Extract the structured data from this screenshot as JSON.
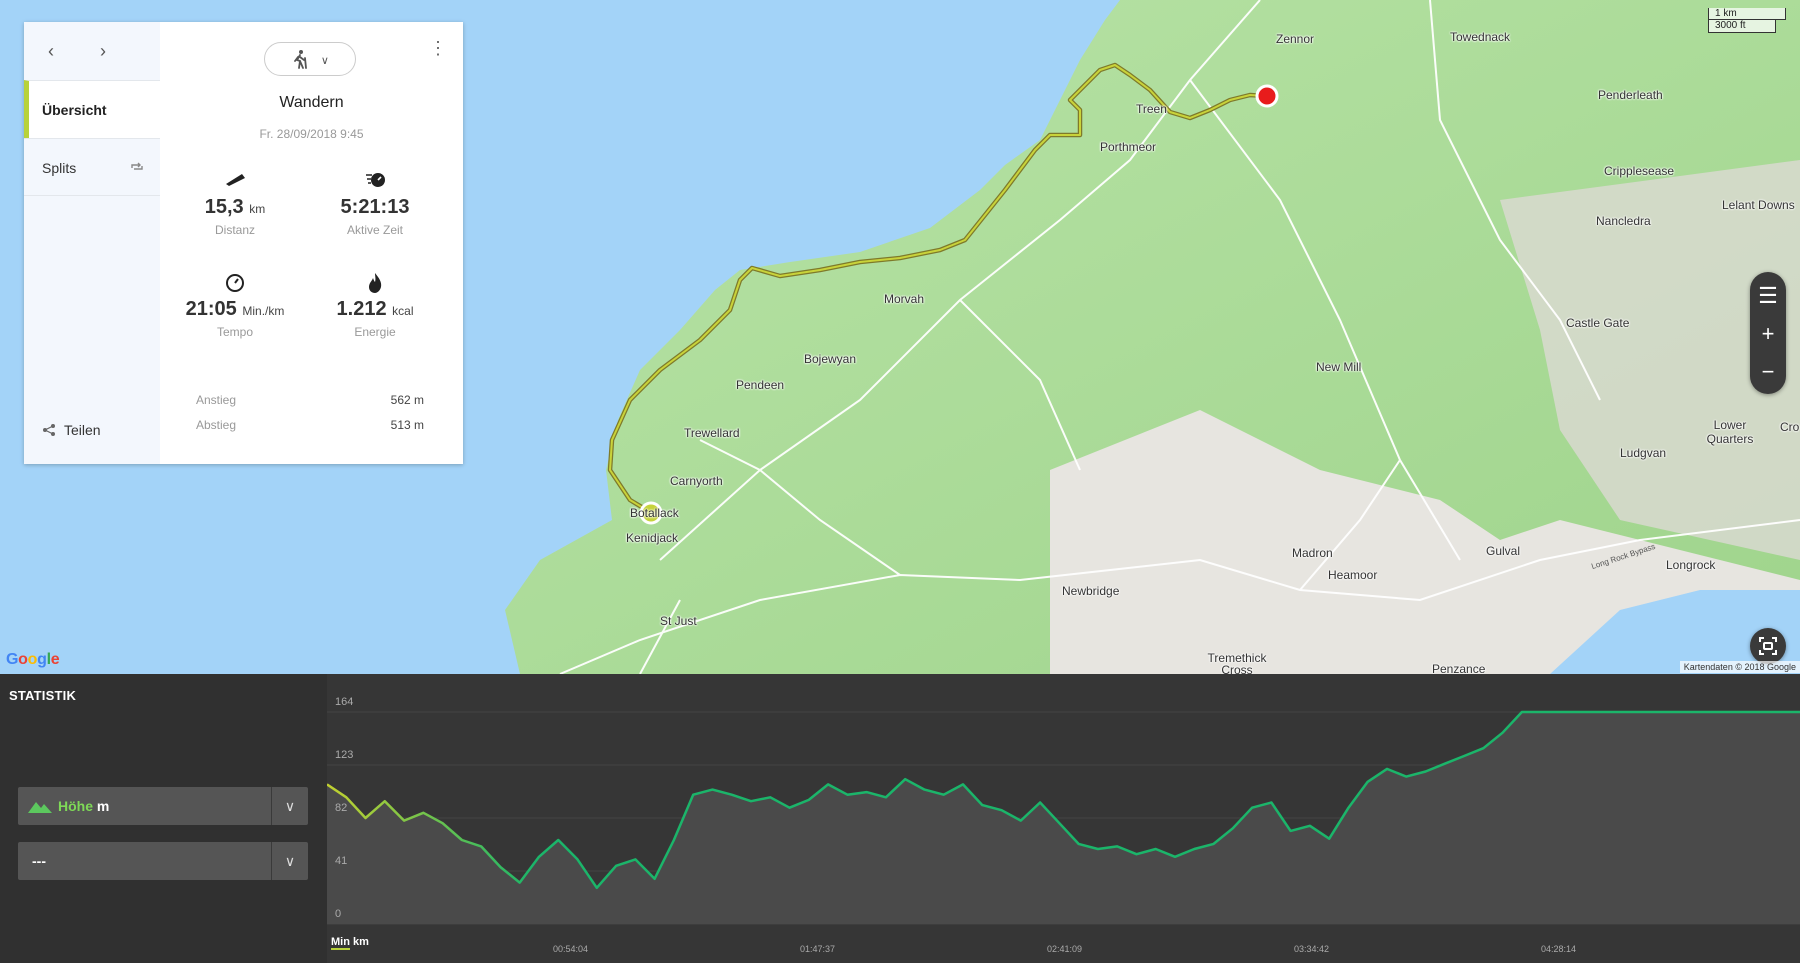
{
  "map": {
    "places": [
      {
        "name": "Zennor",
        "cls": "zennor"
      },
      {
        "name": "Towednack",
        "cls": "towednack"
      },
      {
        "name": "Penderleath",
        "cls": "penderleath"
      },
      {
        "name": "Treen",
        "cls": "treen"
      },
      {
        "name": "Porthmeor",
        "cls": "porthmeor"
      },
      {
        "name": "Crippleseasе",
        "cls": "crip"
      },
      {
        "name": "Nancledra",
        "cls": "nancledra"
      },
      {
        "name": "Lelant Downs",
        "cls": "lelant"
      },
      {
        "name": "Castle Gate",
        "cls": "castlegate"
      },
      {
        "name": "Morvah",
        "cls": "morvah"
      },
      {
        "name": "Bojewyan",
        "cls": "bojewyan"
      },
      {
        "name": "Pendeen",
        "cls": "pendeen"
      },
      {
        "name": "New Mill",
        "cls": "newmill"
      },
      {
        "name": "Trewellard",
        "cls": "trewellard"
      },
      {
        "name": "Carnyorth",
        "cls": "carnyorth"
      },
      {
        "name": "Botallack",
        "cls": "botallack"
      },
      {
        "name": "Kenidjack",
        "cls": "kenidjack"
      },
      {
        "name": "Lower Quarters",
        "cls": "lowerq"
      },
      {
        "name": "Ludgvan",
        "cls": "ludgvan"
      },
      {
        "name": "Gulval",
        "cls": "gulval"
      },
      {
        "name": "Madron",
        "cls": "madron"
      },
      {
        "name": "Heamoor",
        "cls": "heamoor"
      },
      {
        "name": "Longrock",
        "cls": "longrock"
      },
      {
        "name": "Long Rock Bypass",
        "cls": "lrbypass"
      },
      {
        "name": "Newbridge",
        "cls": "newbridge"
      },
      {
        "name": "St Just",
        "cls": "stjust"
      },
      {
        "name": "Tremethick Cross",
        "cls": "tremethick"
      },
      {
        "name": "Penzance",
        "cls": "penzance"
      },
      {
        "name": "Cro",
        "cls": "cro"
      }
    ],
    "scale_km": "1 km",
    "scale_ft": "3000 ft",
    "google": "Google",
    "attribution": "Kartendaten © 2018 Google",
    "controls": {
      "menu": "☰",
      "plus": "+",
      "minus": "−"
    }
  },
  "card": {
    "nav_back": "‹",
    "nav_forward": "›",
    "sidebar": [
      {
        "label": "Übersicht"
      },
      {
        "label": "Splits"
      }
    ],
    "share_label": "Teilen",
    "activity_type": "Wandern",
    "date": "Fr. 28/09/2018 9:45",
    "stats": {
      "distance": {
        "value": "15,3",
        "unit": "km",
        "label": "Distanz"
      },
      "active_time": {
        "value": "5:21:13",
        "unit": "",
        "label": "Aktive Zeit"
      },
      "pace": {
        "value": "21:05",
        "unit": "Min./km",
        "label": "Tempo"
      },
      "energy": {
        "value": "1.212",
        "unit": "kcal",
        "label": "Energie"
      }
    },
    "ascent": {
      "label": "Anstieg",
      "value": "562 m"
    },
    "descent": {
      "label": "Abstieg",
      "value": "513 m"
    }
  },
  "stats_panel": {
    "title": "STATISTIK",
    "select1": {
      "label": "Höhe",
      "unit": "m"
    },
    "select2": {
      "label": "---"
    },
    "x_units": {
      "min": "Min",
      "km": "km"
    }
  },
  "chart_data": {
    "type": "area",
    "title": "",
    "ylabel": "",
    "xlabel": "",
    "yticks": [
      0,
      41,
      82,
      123,
      164
    ],
    "xticks": [
      "00:54:04",
      "01:47:37",
      "02:41:09",
      "03:34:42",
      "04:28:14"
    ],
    "ylim": [
      0,
      164
    ],
    "xlim": [
      0,
      5.35
    ],
    "x": [
      0,
      0.07,
      0.14,
      0.21,
      0.28,
      0.35,
      0.42,
      0.49,
      0.56,
      0.63,
      0.7,
      0.77,
      0.84,
      0.91,
      0.98,
      1.05,
      1.12,
      1.19,
      1.26,
      1.33,
      1.4,
      1.47,
      1.54,
      1.61,
      1.68,
      1.75,
      1.82,
      1.89,
      1.96,
      2.03,
      2.1,
      2.17,
      2.24,
      2.31,
      2.38,
      2.45,
      2.52,
      2.59,
      2.66,
      2.73,
      2.8,
      2.87,
      2.94,
      3.01,
      3.08,
      3.15,
      3.22,
      3.29,
      3.36,
      3.43,
      3.5,
      3.57,
      3.64,
      3.71,
      3.78,
      3.85,
      3.92,
      3.99,
      4.06,
      4.13,
      4.2,
      4.27,
      4.34,
      4.41,
      4.48,
      4.55,
      4.62,
      4.69,
      4.76,
      4.83,
      4.9,
      4.97,
      5.04,
      5.11,
      5.18,
      5.25,
      5.35
    ],
    "series": [
      {
        "values": [
          108,
          98,
          82,
          95,
          80,
          86,
          78,
          65,
          60,
          44,
          32,
          52,
          65,
          50,
          28,
          45,
          50,
          35,
          65,
          100,
          104,
          100,
          95,
          98,
          90,
          96,
          108,
          100,
          102,
          98,
          112,
          104,
          100,
          108,
          92,
          88,
          80,
          94,
          78,
          62,
          58,
          60,
          54,
          58,
          52,
          58,
          62,
          74,
          90,
          94,
          72,
          76,
          66,
          90,
          110,
          120,
          114,
          118,
          124,
          130,
          136,
          148,
          164,
          164,
          164,
          164,
          164,
          164,
          164,
          164,
          164,
          164,
          164,
          164,
          164,
          164,
          164
        ],
        "colors_start": "#c2d130",
        "colors_end": "#1bb56a"
      }
    ]
  }
}
